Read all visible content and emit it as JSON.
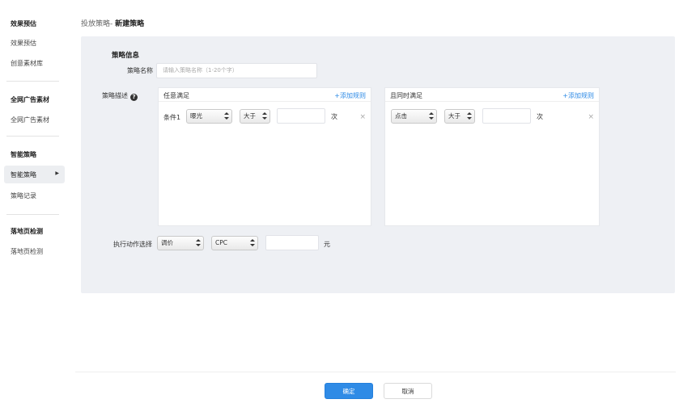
{
  "sidebar": {
    "groups": [
      {
        "title": "效果预估",
        "items": [
          "效果预估",
          "创意素材库"
        ]
      },
      {
        "title": "全网广告素材",
        "items": [
          "全网广告素材"
        ]
      },
      {
        "title": "智能策略",
        "items": [
          "智能策略",
          "策略记录"
        ]
      },
      {
        "title": "落地页检测",
        "items": [
          "落地页检测"
        ]
      }
    ],
    "active_item": "智能策略"
  },
  "header": {
    "breadcrumb": "投放策略-",
    "current": "新建策略"
  },
  "form": {
    "section_title": "策略信息",
    "name_label": "策略名称",
    "name_placeholder": "请输入策略名称（1-20个字）",
    "desc_label": "策略描述",
    "help_icon": "?",
    "rule_any": {
      "title": "任意满足",
      "add_label": "+添加规则",
      "condition_label": "条件1",
      "metric": "曝光",
      "operator": "大于",
      "value": "",
      "unit": "次",
      "remove": "×"
    },
    "rule_all": {
      "title": "且同时满足",
      "add_label": "+添加规则",
      "metric": "点击",
      "operator": "大于",
      "value": "",
      "unit": "次",
      "remove": "×"
    },
    "action_label": "执行动作选择",
    "action": "调价",
    "bid_type": "CPC",
    "amount": "",
    "amount_unit": "元"
  },
  "footer": {
    "confirm": "确定",
    "cancel": "取消"
  },
  "colors": {
    "primary": "#2f8be6",
    "panel_bg": "#eef0f4"
  }
}
